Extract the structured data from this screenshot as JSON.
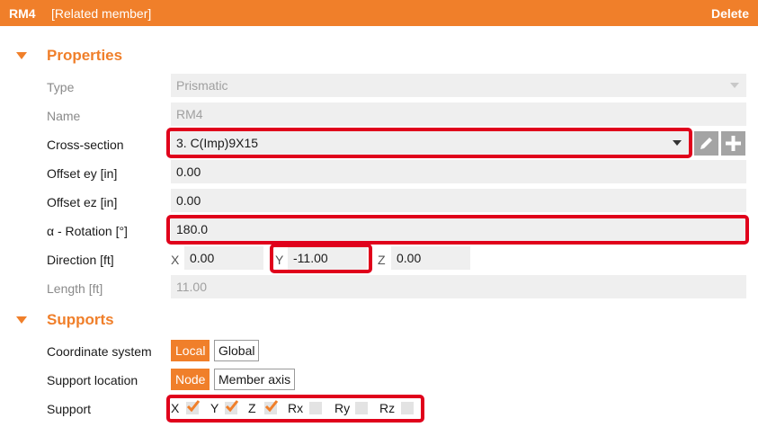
{
  "header": {
    "title": "RM4",
    "subtitle": "[Related member]",
    "delete_label": "Delete"
  },
  "colors": {
    "accent": "#f07f2a",
    "highlight": "#e0001b"
  },
  "properties": {
    "section_title": "Properties",
    "type": {
      "label": "Type",
      "value": "Prismatic"
    },
    "name": {
      "label": "Name",
      "value": "RM4"
    },
    "cross_section": {
      "label": "Cross-section",
      "value": "3. C(Imp)9X15",
      "icons": [
        "pencil-icon",
        "plus-icon"
      ]
    },
    "offset_ey": {
      "label": "Offset ey [in]",
      "value": "0.00"
    },
    "offset_ez": {
      "label": "Offset ez [in]",
      "value": "0.00"
    },
    "rotation": {
      "label": "α - Rotation [°]",
      "value": "180.0"
    },
    "direction": {
      "label": "Direction [ft]",
      "x_label": "X",
      "x_value": "0.00",
      "y_label": "Y",
      "y_value": "-11.00",
      "z_label": "Z",
      "z_value": "0.00"
    },
    "length": {
      "label": "Length [ft]",
      "value": "11.00"
    }
  },
  "supports": {
    "section_title": "Supports",
    "coordinate_system": {
      "label": "Coordinate system",
      "options": [
        "Local",
        "Global"
      ],
      "selected": "Local"
    },
    "support_location": {
      "label": "Support location",
      "options": [
        "Node",
        "Member axis"
      ],
      "selected": "Node"
    },
    "support": {
      "label": "Support",
      "items": [
        {
          "label": "X",
          "checked": true
        },
        {
          "label": "Y",
          "checked": true
        },
        {
          "label": "Z",
          "checked": true
        },
        {
          "label": "Rx",
          "checked": false
        },
        {
          "label": "Ry",
          "checked": false
        },
        {
          "label": "Rz",
          "checked": false
        }
      ]
    }
  }
}
